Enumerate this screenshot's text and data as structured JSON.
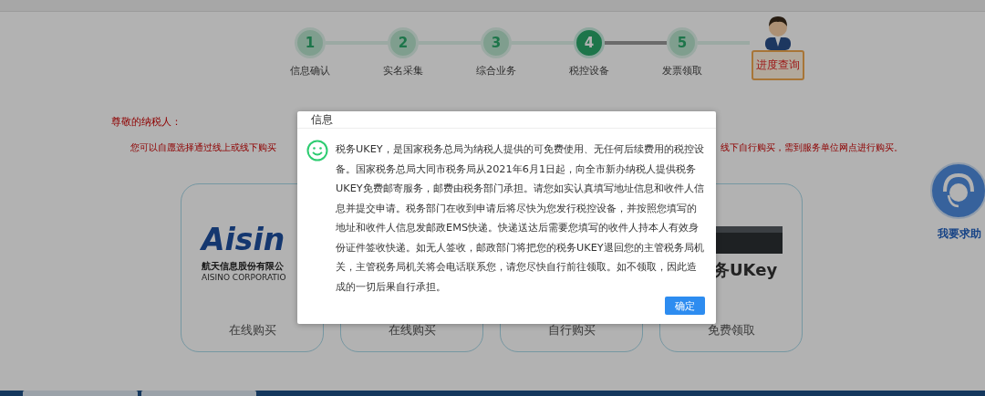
{
  "steps": [
    {
      "number": "1",
      "label": "信息确认",
      "selected": false
    },
    {
      "number": "2",
      "label": "实名采集",
      "selected": false
    },
    {
      "number": "3",
      "label": "综合业务",
      "selected": false
    },
    {
      "number": "4",
      "label": "税控设备",
      "selected": true
    },
    {
      "number": "5",
      "label": "发票领取",
      "selected": false
    }
  ],
  "progress_query": "进度查询",
  "notice": {
    "greeting": "尊敬的纳税人：",
    "line_left": "您可以自愿选择通过线上或线下购买",
    "line_right": "线下自行购买，需到服务单位网点进行购买。"
  },
  "cards": [
    {
      "kind": "aisino",
      "logo": "Aisin",
      "company": "航天信息股份有限公",
      "company_en": "AISINO CORPORATIO",
      "label": "在线购买"
    },
    {
      "kind": "plain",
      "label": "在线购买"
    },
    {
      "kind": "plain",
      "label": "自行购买"
    },
    {
      "kind": "ukey",
      "caption": "务UKey",
      "label": "免费领取"
    }
  ],
  "help": "我要求助",
  "dialog": {
    "title": "信息",
    "message": "税务UKEY，是国家税务总局为纳税人提供的可免费使用、无任何后续费用的税控设备。国家税务总局大同市税务局从2021年6月1日起，向全市新办纳税人提供税务UKEY免费邮寄服务，邮费由税务部门承担。请您如实认真填写地址信息和收件人信息并提交申请。税务部门在收到申请后将尽快为您发行税控设备，并按照您填写的地址和收件人信息发邮政EMS快递。快递送达后需要您填写的收件人持本人有效身份证件签收快递。如无人签收，邮政部门将把您的税务UKEY退回您的主管税务局机关，主管税务局机关将会电话联系您，请您尽快自行前往领取。如不领取，因此造成的一切后果自行承担。",
    "button": "确定"
  }
}
